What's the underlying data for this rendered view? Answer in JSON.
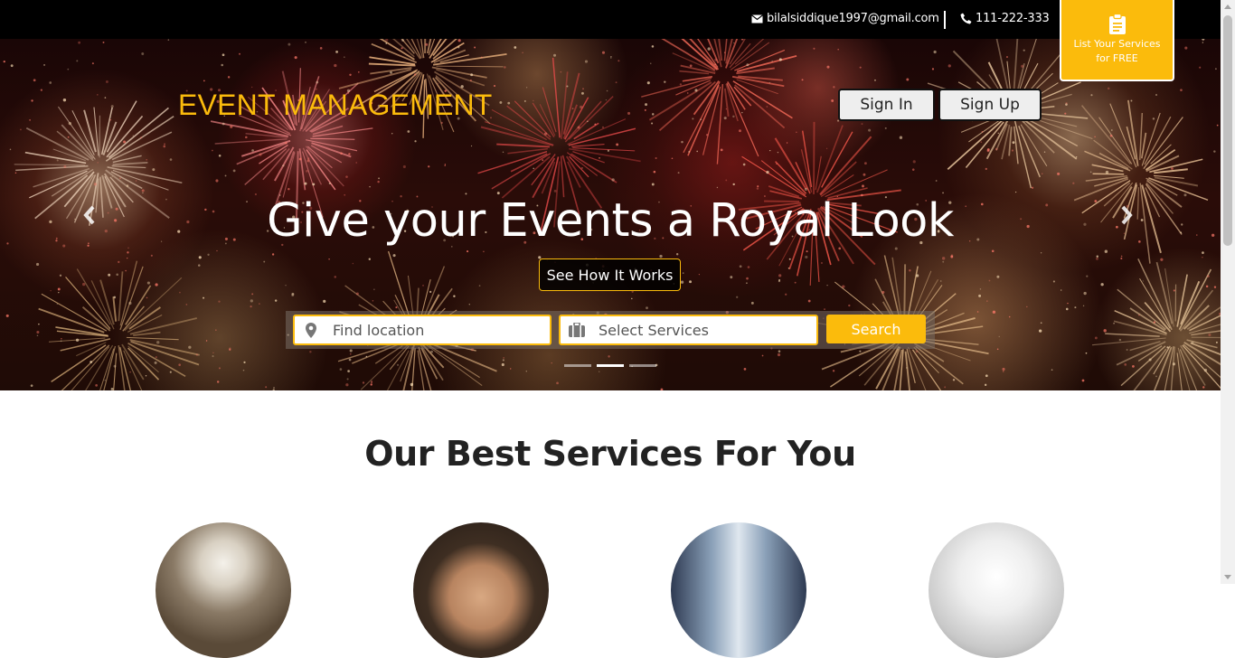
{
  "topbar": {
    "email": "bilalsiddique1997@gmail.com",
    "phone": "111-222-333",
    "list_services": "List Your Services for FREE"
  },
  "header": {
    "brand": "EVENT MANAGEMENT",
    "signin_label": "Sign In",
    "signup_label": "Sign Up"
  },
  "hero": {
    "headline": "Give your Events a Royal Look",
    "cta_label": "See How It Works",
    "prev_icon": "chevron-left-icon",
    "next_icon": "chevron-right-icon",
    "slides": 3,
    "active_slide": 2
  },
  "search": {
    "location_placeholder": "Find location",
    "services_placeholder": "Select Services",
    "button_label": "Search"
  },
  "services": {
    "title": "Our Best Services For You"
  },
  "colors": {
    "accent": "#fbbb0c",
    "topbar": "#000000",
    "heading": "#222222"
  }
}
